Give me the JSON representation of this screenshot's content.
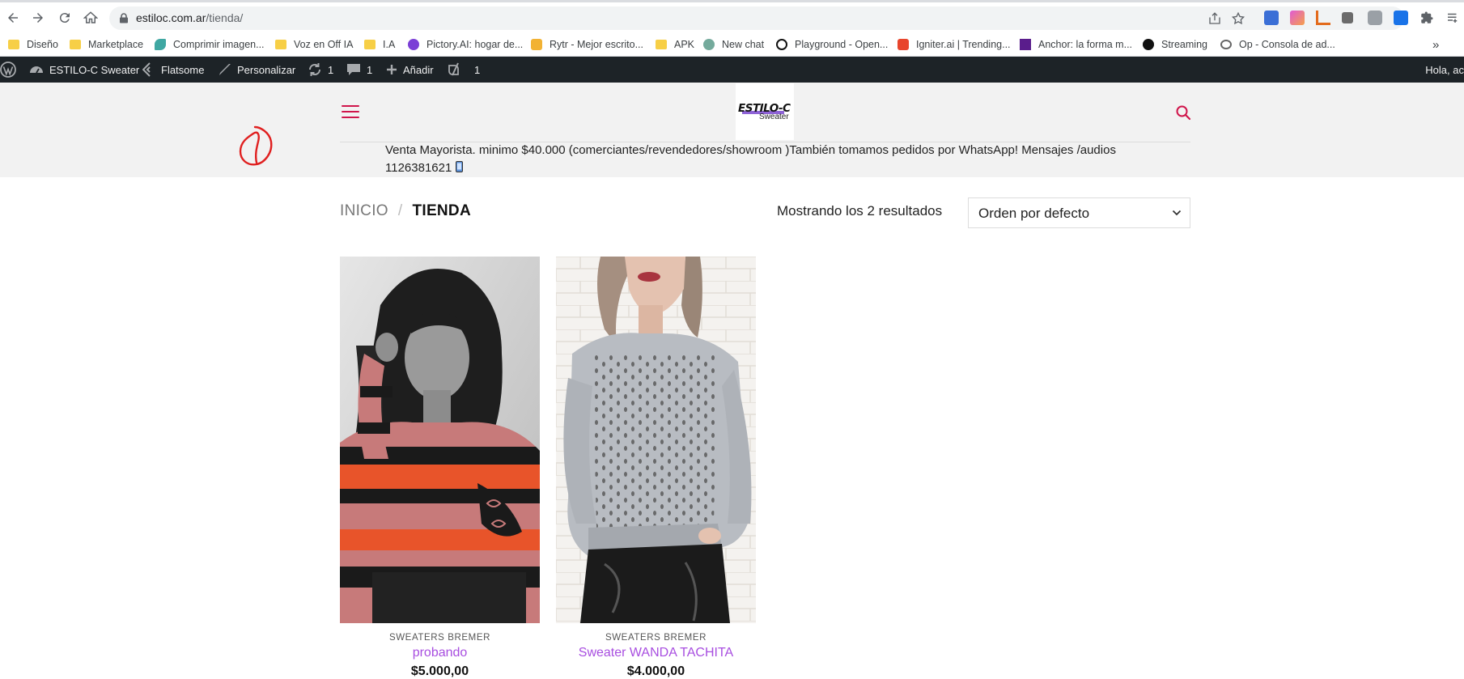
{
  "browser": {
    "url_host": "estiloc.com.ar",
    "url_path": "/tienda/",
    "bookmarks": [
      {
        "label": "Diseño",
        "icon": "folder-icon"
      },
      {
        "label": "Marketplace",
        "icon": "folder-icon"
      },
      {
        "label": "Comprimir imagen...",
        "icon": "compress-icon"
      },
      {
        "label": "Voz en Off IA",
        "icon": "folder-icon"
      },
      {
        "label": "I.A",
        "icon": "folder-icon"
      },
      {
        "label": "Pictory.AI: hogar de...",
        "icon": "pictory-icon"
      },
      {
        "label": "Rytr - Mejor escrito...",
        "icon": "rytr-icon"
      },
      {
        "label": "APK",
        "icon": "folder-icon"
      },
      {
        "label": "New chat",
        "icon": "chatgpt-icon"
      },
      {
        "label": "Playground - Open...",
        "icon": "openai-icon"
      },
      {
        "label": "Igniter.ai | Trending...",
        "icon": "igniter-icon"
      },
      {
        "label": "Anchor: la forma m...",
        "icon": "anchor-icon"
      },
      {
        "label": "Streaming",
        "icon": "streaming-icon"
      },
      {
        "label": "Op - Consola de ad...",
        "icon": "op-icon"
      }
    ],
    "overflow_label": "»"
  },
  "adminbar": {
    "site_name": "ESTILO-C Sweater",
    "theme": "Flatsome",
    "customize": "Personalizar",
    "updates_count": "1",
    "comments_count": "1",
    "add_new": "Añadir",
    "yoast_count": "1",
    "greeting": "Hola, ac"
  },
  "header": {
    "logo_title": "ESTILO-C",
    "logo_subtitle": "Sweater",
    "banner_text": "Venta Mayorista. minimo $40.000 (comerciantes/revendedores/showroom )También tomamos pedidos por WhatsApp! Mensajes /audios 1126381621",
    "accent_color": "#d0154b"
  },
  "shop": {
    "breadcrumb_home": "INICIO",
    "breadcrumb_separator": "/",
    "breadcrumb_current": "TIENDA",
    "result_count": "Mostrando los 2 resultados",
    "orderby_selected": "Orden por defecto",
    "products": [
      {
        "category": "SWEATERS BREMER",
        "name": "probando",
        "price": "$5.000,00"
      },
      {
        "category": "SWEATERS BREMER",
        "name": "Sweater WANDA TACHITA",
        "price": "$4.000,00"
      }
    ],
    "name_color": "#a84ee0"
  }
}
